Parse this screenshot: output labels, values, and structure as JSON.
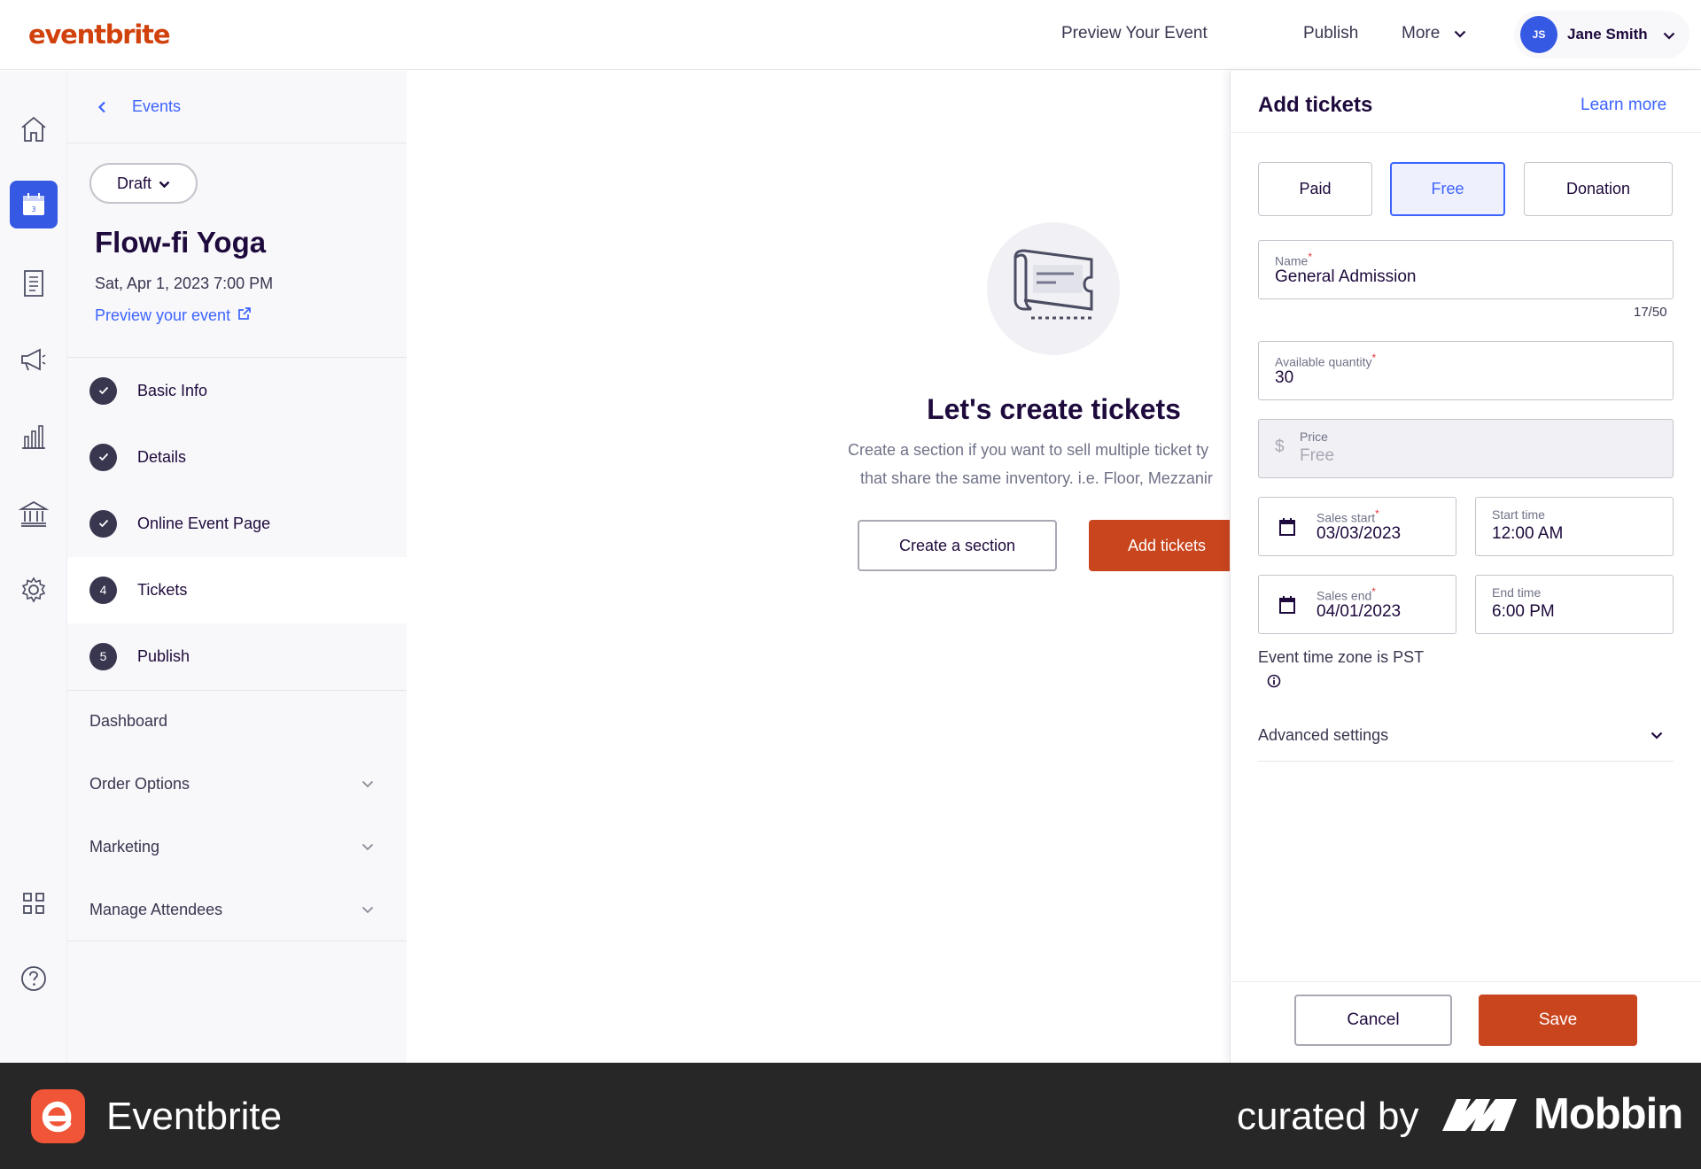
{
  "header": {
    "logo": "eventbrite",
    "nav": {
      "preview": "Preview Your Event",
      "publish": "Publish",
      "more": "More"
    },
    "user": {
      "initials": "JS",
      "name": "Jane Smith"
    }
  },
  "rail": {
    "icons": [
      "home-icon",
      "calendar-icon",
      "orders-icon",
      "marketing-icon",
      "reports-icon",
      "finance-icon",
      "settings-icon",
      "apps-icon",
      "help-icon"
    ],
    "active": "calendar-icon"
  },
  "sidebar": {
    "back_label": "Events",
    "status": "Draft",
    "event_title": "Flow-fi Yoga",
    "event_date": "Sat, Apr 1, 2023 7:00 PM",
    "preview_link": "Preview your event",
    "steps": [
      {
        "label": "Basic Info",
        "state": "done"
      },
      {
        "label": "Details",
        "state": "done"
      },
      {
        "label": "Online Event Page",
        "state": "done"
      },
      {
        "label": "Tickets",
        "number": "4",
        "state": "active"
      },
      {
        "label": "Publish",
        "number": "5",
        "state": "todo"
      }
    ],
    "menu": [
      {
        "label": "Dashboard",
        "expandable": false
      },
      {
        "label": "Order Options",
        "expandable": true
      },
      {
        "label": "Marketing",
        "expandable": true
      },
      {
        "label": "Manage Attendees",
        "expandable": true
      }
    ]
  },
  "main": {
    "heading": "Let's create tickets",
    "description_line1": "Create a section if you want to sell multiple ticket ty",
    "description_line2": "that share the same inventory. i.e. Floor, Mezzanir",
    "create_section": "Create a section",
    "add_tickets": "Add tickets"
  },
  "panel": {
    "title": "Add tickets",
    "learn_more": "Learn more",
    "ticket_types": [
      "Paid",
      "Free",
      "Donation"
    ],
    "selected_type": "Free",
    "name": {
      "label": "Name",
      "value": "General Admission",
      "counter": "17/50"
    },
    "quantity": {
      "label": "Available quantity",
      "value": "30"
    },
    "price": {
      "label": "Price",
      "symbol": "$",
      "value": "Free"
    },
    "sales_start": {
      "label": "Sales start",
      "value": "03/03/2023"
    },
    "start_time": {
      "label": "Start time",
      "value": "12:00 AM"
    },
    "sales_end": {
      "label": "Sales end",
      "value": "04/01/2023"
    },
    "end_time": {
      "label": "End time",
      "value": "6:00 PM"
    },
    "timezone": "Event time zone is PST",
    "advanced": "Advanced settings",
    "cancel": "Cancel",
    "save": "Save"
  },
  "banner": {
    "app_name": "Eventbrite",
    "curated_by": "curated by",
    "brand": "Mobbin"
  },
  "colors": {
    "brand_orange": "#d1410c",
    "button_orange": "#c9451d",
    "link_blue": "#3d64ff",
    "avatar_blue": "#3659e3",
    "text_dark": "#1e0a3c"
  }
}
